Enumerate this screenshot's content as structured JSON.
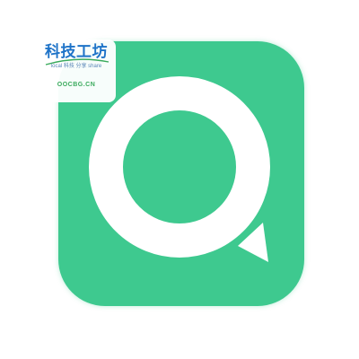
{
  "app_icon": {
    "icon": "chat-bubble-icon",
    "background_color": "#3ec98f",
    "ring_color": "#ffffff"
  },
  "watermark": {
    "title": "科技工坊",
    "subtitle": "local 科技 分享 share",
    "url": "OOCBG.CN",
    "title_color": "#1e73c8",
    "url_color": "#3aaa5c"
  }
}
